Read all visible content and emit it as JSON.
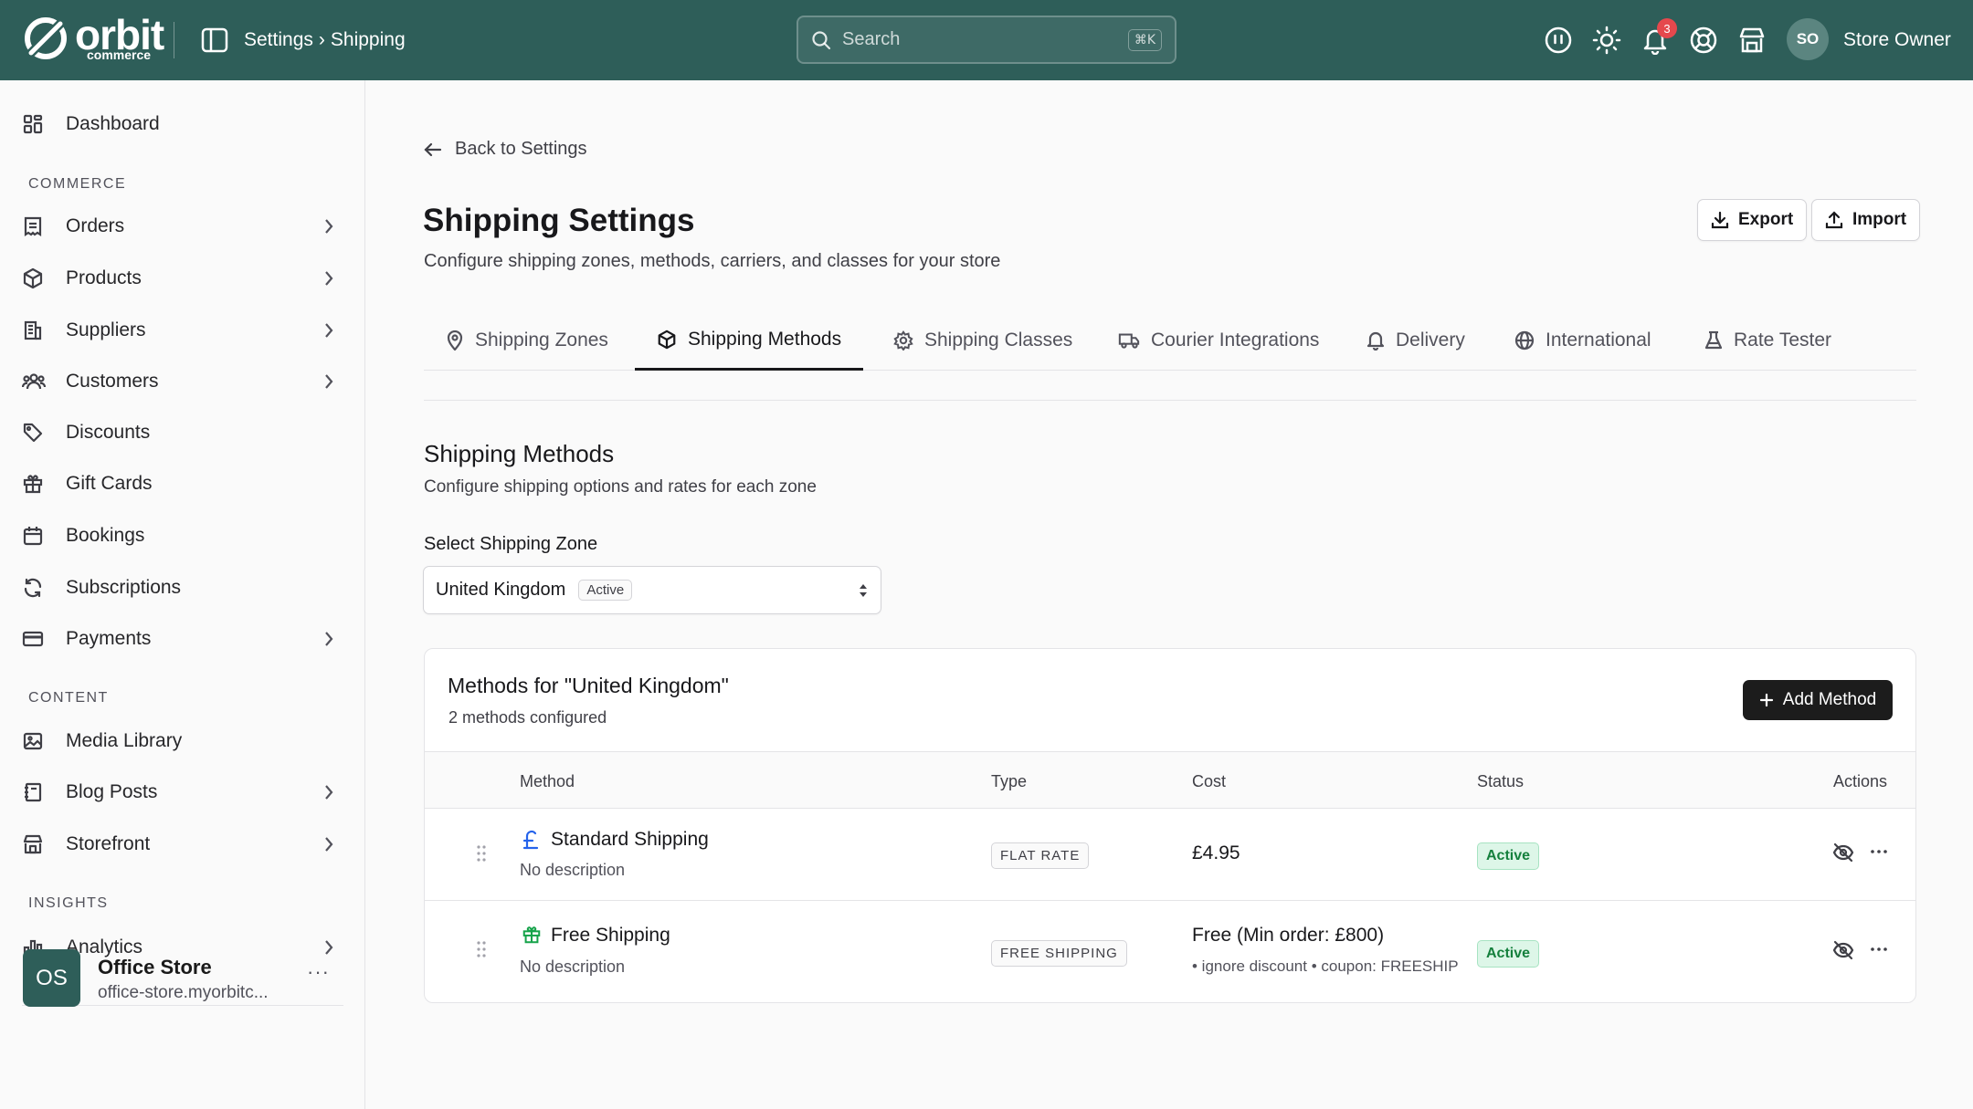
{
  "header": {
    "logo_text": "orbit",
    "logo_sub": "commerce",
    "breadcrumb": {
      "parent": "Settings",
      "separator": "›",
      "current": "Shipping"
    },
    "search": {
      "placeholder": "Search",
      "shortcut": "⌘K"
    },
    "notifications_count": "3",
    "user": {
      "initials": "SO",
      "name": "Store Owner"
    }
  },
  "sidebar": {
    "dashboard": "Dashboard",
    "sections": {
      "commerce": "COMMERCE",
      "content": "CONTENT",
      "insights": "INSIGHTS"
    },
    "commerce_items": [
      {
        "label": "Orders",
        "icon": "receipt-icon",
        "expandable": true
      },
      {
        "label": "Products",
        "icon": "package-icon",
        "expandable": true
      },
      {
        "label": "Suppliers",
        "icon": "building-icon",
        "expandable": true
      },
      {
        "label": "Customers",
        "icon": "users-icon",
        "expandable": true
      },
      {
        "label": "Discounts",
        "icon": "tag-icon",
        "expandable": false
      },
      {
        "label": "Gift Cards",
        "icon": "gift-icon",
        "expandable": false
      },
      {
        "label": "Bookings",
        "icon": "calendar-icon",
        "expandable": false
      },
      {
        "label": "Subscriptions",
        "icon": "refresh-icon",
        "expandable": false
      },
      {
        "label": "Payments",
        "icon": "credit-card-icon",
        "expandable": true
      }
    ],
    "content_items": [
      {
        "label": "Media Library",
        "icon": "image-icon",
        "expandable": false
      },
      {
        "label": "Blog Posts",
        "icon": "notebook-icon",
        "expandable": true
      },
      {
        "label": "Storefront",
        "icon": "store-icon",
        "expandable": true
      }
    ],
    "insights_items": [
      {
        "label": "Analytics",
        "icon": "bar-chart-icon",
        "expandable": true
      }
    ],
    "store": {
      "initials": "OS",
      "name": "Office Store",
      "url": "office-store.myorbitc..."
    }
  },
  "main": {
    "back_label": "Back to Settings",
    "title": "Shipping Settings",
    "subtitle": "Configure shipping zones, methods, carriers, and classes for your store",
    "export_label": "Export",
    "import_label": "Import",
    "tabs": [
      {
        "label": "Shipping Zones",
        "icon": "map-pin-icon"
      },
      {
        "label": "Shipping Methods",
        "icon": "box-icon",
        "active": true
      },
      {
        "label": "Shipping Classes",
        "icon": "gear-icon"
      },
      {
        "label": "Courier Integrations",
        "icon": "truck-icon"
      },
      {
        "label": "Delivery",
        "icon": "bell-icon"
      },
      {
        "label": "International",
        "icon": "globe-icon"
      },
      {
        "label": "Rate Tester",
        "icon": "flask-icon"
      }
    ],
    "methods_section": {
      "title": "Shipping Methods",
      "subtitle": "Configure shipping options and rates for each zone",
      "zone_label": "Select Shipping Zone",
      "zone_value": "United Kingdom",
      "zone_status": "Active"
    },
    "methods_card": {
      "title": "Methods for \"United Kingdom\"",
      "subtitle": "2 methods configured",
      "add_label": "Add Method",
      "columns": [
        "Method",
        "Type",
        "Cost",
        "Status",
        "Actions"
      ],
      "rows": [
        {
          "icon": "pound-icon",
          "name": "Standard Shipping",
          "description": "No description",
          "type": "FLAT RATE",
          "cost": "£4.95",
          "cost_extra": "",
          "status": "Active"
        },
        {
          "icon": "gift-icon",
          "name": "Free Shipping",
          "description": "No description",
          "type": "FREE SHIPPING",
          "cost": "Free (Min order: £800)",
          "cost_extra": "• ignore discount  • coupon: FREESHIP",
          "status": "Active"
        }
      ]
    }
  },
  "colors": {
    "topbar": "#2e5e59",
    "active_badge_bg": "#ddf6e8",
    "active_badge_text": "#15803d",
    "primary_button": "#1c1c1c",
    "notification_badge": "#e5484d"
  }
}
